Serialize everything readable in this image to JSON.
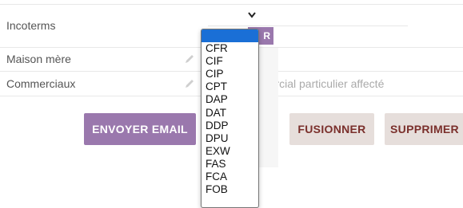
{
  "fields": {
    "incoterms": {
      "label": "Incoterms",
      "button_suffix": "R"
    },
    "maison_mere": {
      "label": "Maison mère"
    },
    "commerciaux": {
      "label": "Commerciaux",
      "placeholder": "mercial particulier affecté"
    }
  },
  "select": {
    "chevron": "chevron-down-icon",
    "selected_index": 0,
    "options": [
      "",
      "CFR",
      "CIF",
      "CIP",
      "CPT",
      "DAP",
      "DAT",
      "DDP",
      "DPU",
      "EXW",
      "FAS",
      "FCA",
      "FOB"
    ]
  },
  "actions": {
    "email": "ENVOYER EMAIL",
    "partial_hidden": "ER",
    "merge": "FUSIONNER",
    "delete": "SUPPRIMER"
  },
  "colors": {
    "accent": "#9a78ad",
    "secondary_bg": "#e6dedb",
    "secondary_text": "#7a2f2b",
    "selection": "#1a6fd6"
  }
}
